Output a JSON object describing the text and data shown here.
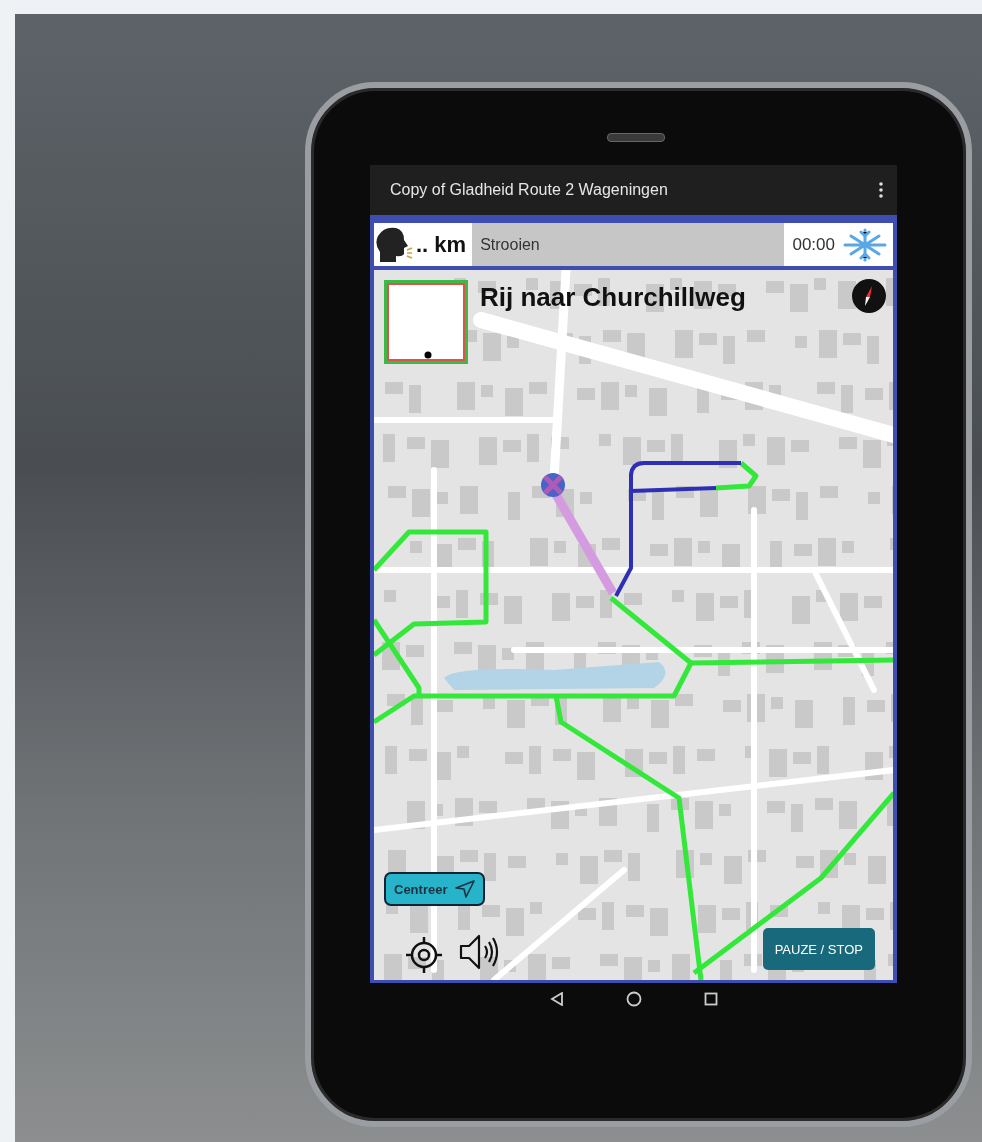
{
  "app_bar": {
    "title": "Copy of Gladheid Route 2 Wageningen"
  },
  "info_bar": {
    "distance": ".. km",
    "task": "Strooien",
    "time": "00:00"
  },
  "instruction": {
    "text": "Rij naar Churchillweg"
  },
  "controls": {
    "center_button": "Centreer",
    "pause_stop_button": "PAUZE / STOP"
  }
}
